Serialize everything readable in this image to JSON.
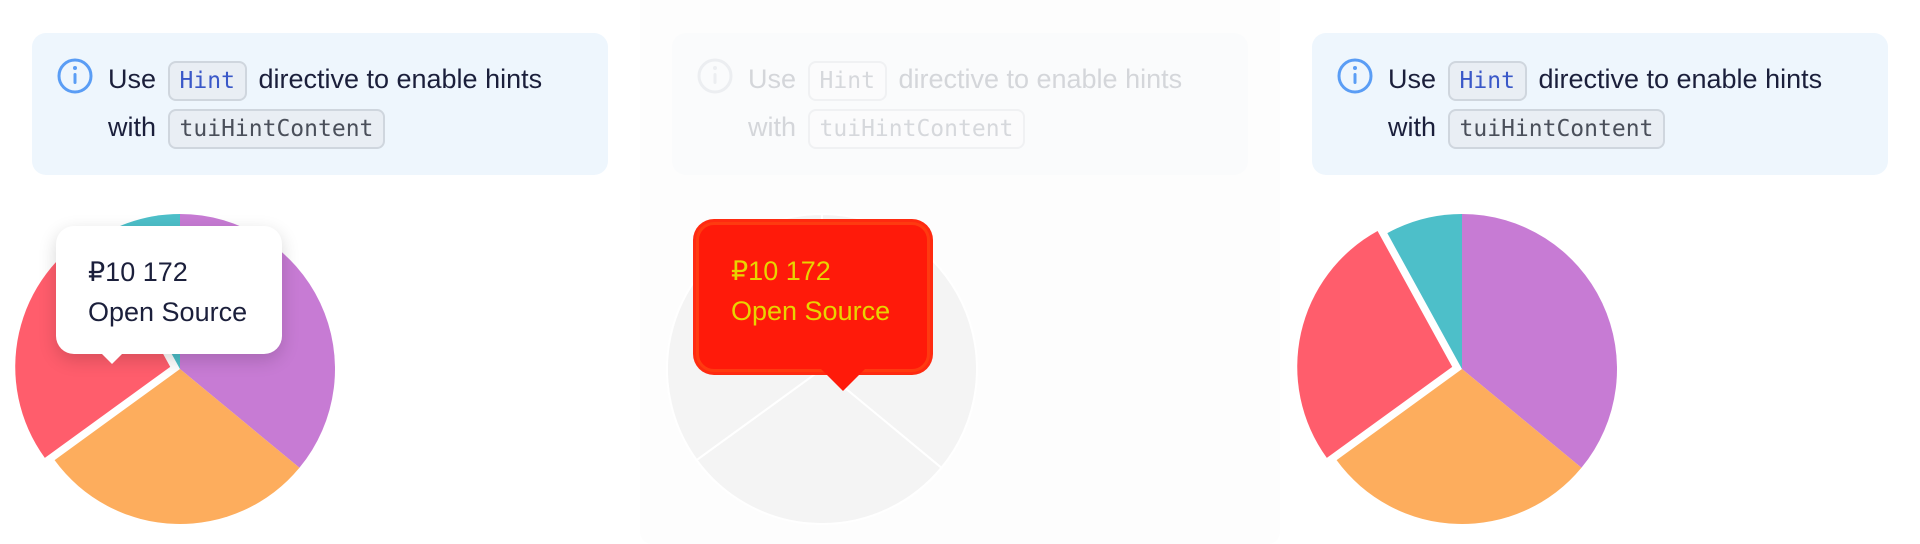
{
  "notice": {
    "before": "Use",
    "directive": "Hint",
    "middle": "directive to enable hints",
    "with": "with",
    "content_directive": "tuiHintContent"
  },
  "tooltip": {
    "value": "₽10 172",
    "label": "Open Source"
  },
  "colors": {
    "purple": "#c77bd4",
    "orange": "#fdad5d",
    "red": "#ff5d6c",
    "teal": "#4dbfc9",
    "lavender": "#9b95d1",
    "disabled": "#f4f4f4",
    "notice_bg": "#eef6fd",
    "info_icon": "#5a9df5"
  },
  "chart_data": [
    {
      "type": "pie",
      "state": "hover",
      "values": [
        36,
        29,
        27,
        8
      ],
      "colors": [
        "#c77bd4",
        "#fdad5d",
        "#ff5d6c",
        "#4dbfc9"
      ],
      "highlighted_index": 2,
      "tooltip": "₽10 172 Open Source"
    },
    {
      "type": "pie",
      "state": "disabled",
      "values": [
        36,
        29,
        27,
        8
      ],
      "colors": [
        "#f4f4f4",
        "#f4f4f4",
        "#f4f4f4",
        "#f4f4f4"
      ]
    },
    {
      "type": "pie",
      "state": "default",
      "values": [
        36,
        29,
        27,
        8
      ],
      "colors": [
        "#c77bd4",
        "#fdad5d",
        "#ff5d6c",
        "#4dbfc9"
      ],
      "highlighted_index": 2
    }
  ]
}
